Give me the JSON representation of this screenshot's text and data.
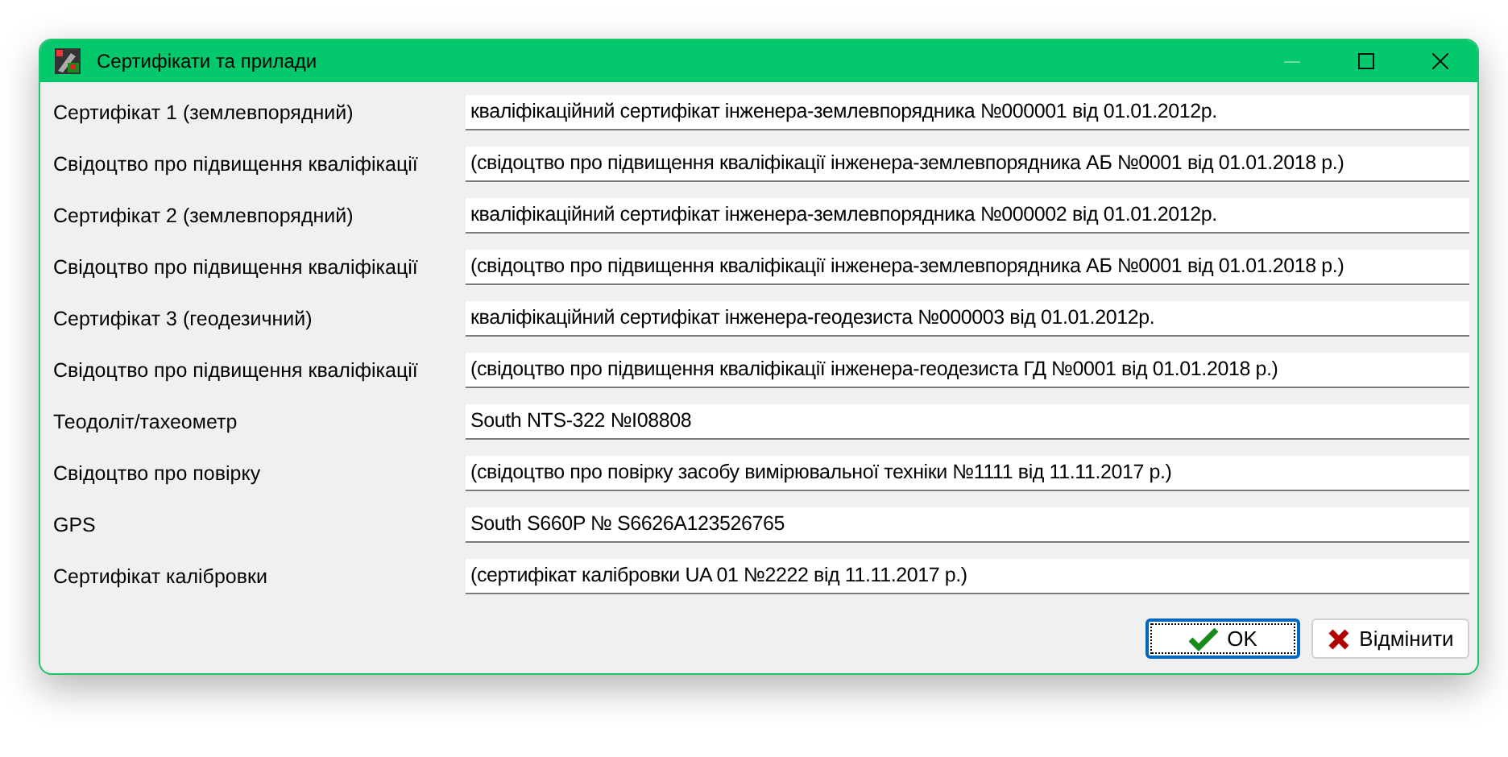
{
  "window": {
    "title": "Сертифікати та прилади",
    "controls": [
      {
        "kind": "minimize",
        "disabled": true
      },
      {
        "kind": "maximize",
        "disabled": false
      },
      {
        "kind": "close",
        "disabled": false
      }
    ]
  },
  "fields": [
    {
      "label": "Сертифікат 1 (землевпорядний)",
      "value": "кваліфікаційний сертифікат інженера-землевпорядника №000001 від 01.01.2012р."
    },
    {
      "label": "Свідоцтво про підвищення кваліфікації",
      "value": "(свідоцтво про підвищення кваліфікації інженера-землевпорядника АБ №0001 від 01.01.2018 р.)"
    },
    {
      "label": "Сертифікат 2 (землевпорядний)",
      "value": "кваліфікаційний сертифікат інженера-землевпорядника №000002 від 01.01.2012р."
    },
    {
      "label": "Свідоцтво про підвищення кваліфікації",
      "value": "(свідоцтво про підвищення кваліфікації інженера-землевпорядника АБ №0001 від 01.01.2018 р.)"
    },
    {
      "label": "Сертифікат 3 (геодезичний)",
      "value": "кваліфікаційний сертифікат інженера-геодезиста №000003 від 01.01.2012р."
    },
    {
      "label": "Свідоцтво про підвищення кваліфікації",
      "value": "(свідоцтво про підвищення кваліфікації інженера-геодезиста ГД №0001 від 01.01.2018 р.)"
    },
    {
      "label": "Теодоліт/тахеометр",
      "value": "South NTS-322 №I08808"
    },
    {
      "label": "Свідоцтво про повірку",
      "value": "(свідоцтво про повірку засобу вимірювальної техніки №1111 від 11.11.2017 р.)"
    },
    {
      "label": "GPS",
      "value": "South S660P № S6626A123526765"
    },
    {
      "label": "Сертифікат калібровки",
      "value": "(сертифікат калібровки UA 01 №2222 від 11.11.2017 р.)"
    }
  ],
  "buttons": [
    {
      "kind": "ok",
      "label": "OK",
      "focused": true
    },
    {
      "kind": "cancel",
      "label": "Відмінити",
      "focused": false
    }
  ]
}
